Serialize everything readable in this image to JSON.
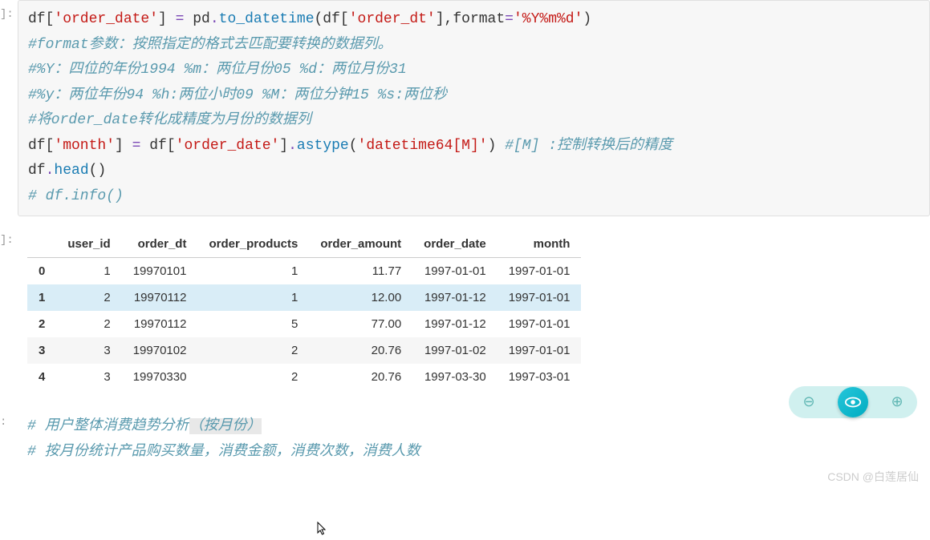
{
  "cell1": {
    "label": "]:",
    "line1": {
      "p1": "df[",
      "s1": "'order_date'",
      "p2": "] ",
      "op": "=",
      "p3": " pd",
      "dot1": ".",
      "fn1": "to_datetime",
      "p4": "(df[",
      "s2": "'order_dt'",
      "p5": "],format",
      "op2": "=",
      "s3": "'%Y%m%d'",
      "p6": ")"
    },
    "line2": "#format参数：按照指定的格式去匹配要转换的数据列。",
    "line3": "#%Y：四位的年份1994    %m：两位月份05   %d：两位月份31",
    "line4": "#%y：两位年份94   %h:两位小时09   %M：两位分钟15     %s:两位秒",
    "line5": "#将order_date转化成精度为月份的数据列",
    "line6": {
      "p1": "df[",
      "s1": "'month'",
      "p2": "] ",
      "op": "=",
      "p3": " df[",
      "s2": "'order_date'",
      "p4": "]",
      "dot": ".",
      "fn": "astype",
      "p5": "(",
      "s3": "'datetime64[M]'",
      "p6": ")   ",
      "cmt": "#[M] :控制转换后的精度"
    },
    "line7": {
      "p1": "df",
      "dot": ".",
      "fn": "head",
      "p2": "()"
    },
    "line8": "# df.info()"
  },
  "output": {
    "label": "]:",
    "headers": [
      "",
      "user_id",
      "order_dt",
      "order_products",
      "order_amount",
      "order_date",
      "month"
    ],
    "rows": [
      [
        "0",
        "1",
        "19970101",
        "1",
        "11.77",
        "1997-01-01",
        "1997-01-01"
      ],
      [
        "1",
        "2",
        "19970112",
        "1",
        "12.00",
        "1997-01-12",
        "1997-01-01"
      ],
      [
        "2",
        "2",
        "19970112",
        "5",
        "77.00",
        "1997-01-12",
        "1997-01-01"
      ],
      [
        "3",
        "3",
        "19970102",
        "2",
        "20.76",
        "1997-01-02",
        "1997-01-01"
      ],
      [
        "4",
        "3",
        "19970330",
        "2",
        "20.76",
        "1997-03-30",
        "1997-03-01"
      ]
    ]
  },
  "cell2": {
    "label": ":",
    "line1a": "# 用户整体消费趋势分析",
    "line1b": "（按月份）",
    "line2": "# 按月份统计产品购买数量，消费金额，消费次数，消费人数"
  },
  "watermark": "CSDN @白莲居仙",
  "float": {
    "minus": "⊖",
    "plus": "⊕"
  },
  "chart_data": {
    "type": "table",
    "columns": [
      "user_id",
      "order_dt",
      "order_products",
      "order_amount",
      "order_date",
      "month"
    ],
    "index": [
      0,
      1,
      2,
      3,
      4
    ],
    "data": [
      [
        1,
        19970101,
        1,
        11.77,
        "1997-01-01",
        "1997-01-01"
      ],
      [
        2,
        19970112,
        1,
        12.0,
        "1997-01-12",
        "1997-01-01"
      ],
      [
        2,
        19970112,
        5,
        77.0,
        "1997-01-12",
        "1997-01-01"
      ],
      [
        3,
        19970102,
        2,
        20.76,
        "1997-01-02",
        "1997-01-01"
      ],
      [
        3,
        19970330,
        2,
        20.76,
        "1997-03-30",
        "1997-03-01"
      ]
    ]
  }
}
